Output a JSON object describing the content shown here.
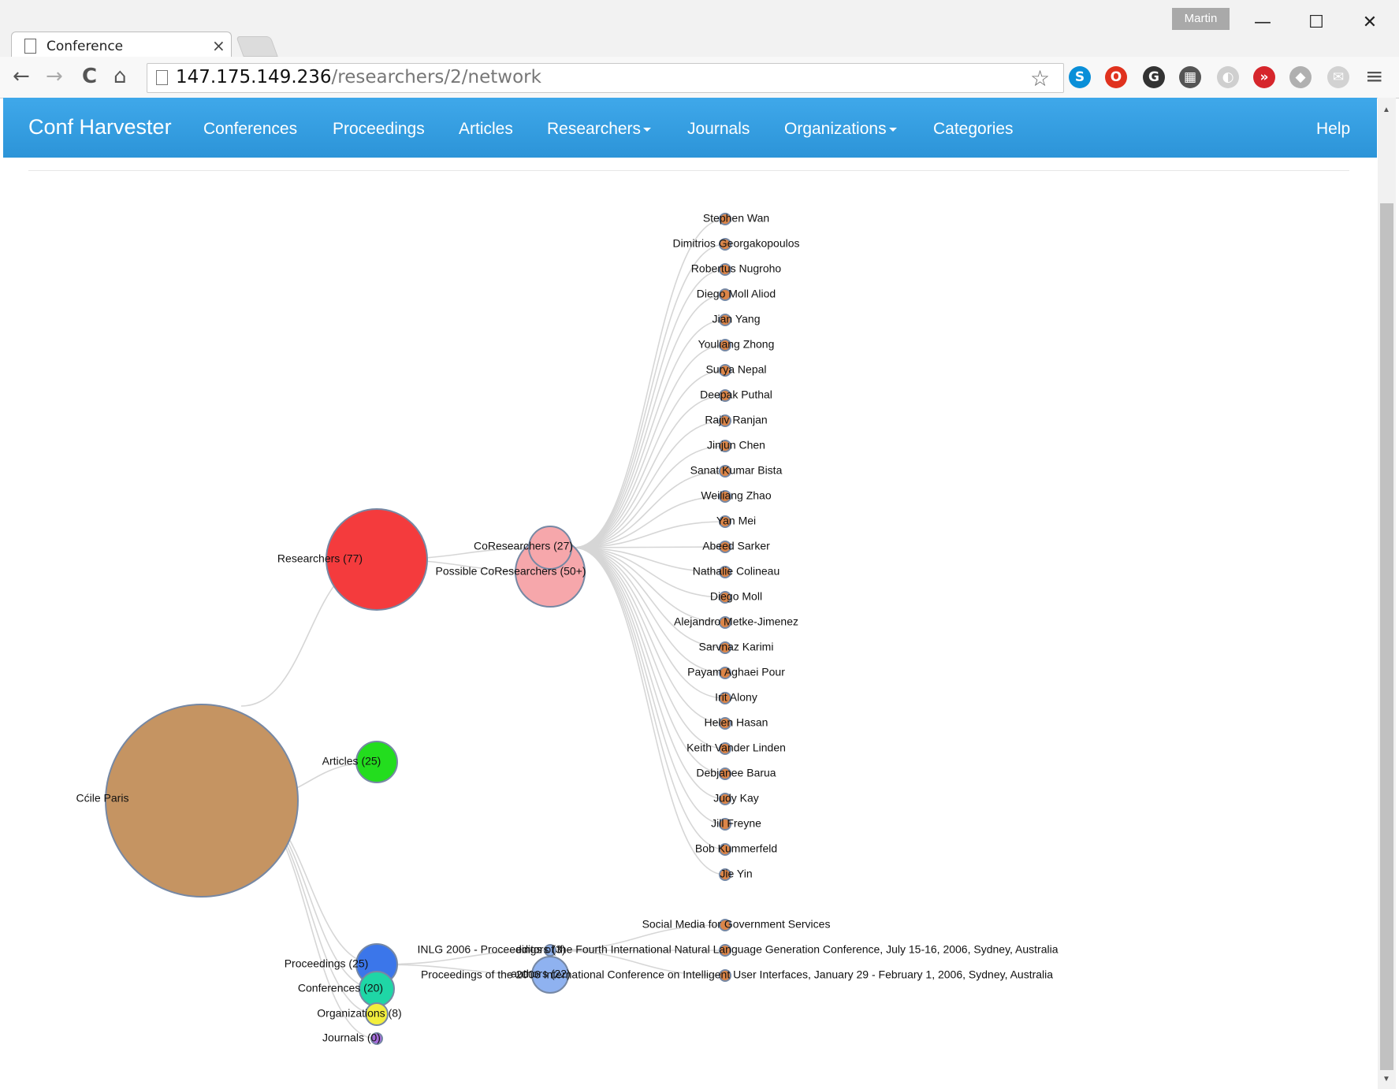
{
  "window": {
    "user_badge": "Martin",
    "minimize": "—",
    "maximize": "☐",
    "close": "✕"
  },
  "tab": {
    "title": "Conference",
    "close": "×"
  },
  "toolbar": {
    "back": "←",
    "forward": "→",
    "reload": "C",
    "home": "⌂",
    "url_host": "147.175.149.236",
    "url_path": "/researchers/2/network",
    "star": "☆",
    "extensions": [
      {
        "icon": "skype-icon",
        "glyph": "S",
        "color": "#0a8fd8"
      },
      {
        "icon": "opera-icon",
        "glyph": "O",
        "color": "#e0321e"
      },
      {
        "icon": "ghostery-icon",
        "glyph": "G",
        "color": "#333333"
      },
      {
        "icon": "clapper-icon",
        "glyph": "▦",
        "color": "#555555"
      },
      {
        "icon": "moon-icon",
        "glyph": "◐",
        "color": "#cfcfcf"
      },
      {
        "icon": "forward-icon",
        "glyph": "»",
        "color": "#d6262c"
      },
      {
        "icon": "box-icon",
        "glyph": "◆",
        "color": "#b0b0b0"
      },
      {
        "icon": "mail-icon",
        "glyph": "✉",
        "color": "#d2d2d2"
      }
    ],
    "menu": "≡"
  },
  "navbar": {
    "brand": "Conf Harvester",
    "links": [
      "Conferences",
      "Proceedings",
      "Articles",
      "Researchers",
      "Journals",
      "Organizations",
      "Categories"
    ],
    "help": "Help"
  },
  "graph": {
    "root": {
      "label": "Cćile Paris",
      "color": "#c59462"
    },
    "categories": [
      {
        "key": "researchers",
        "label": "Researchers (77)",
        "color": "#f43b3d"
      },
      {
        "key": "articles",
        "label": "Articles (25)",
        "color": "#23dd1e"
      },
      {
        "key": "proceedings",
        "label": "Proceedings (25)",
        "color": "#3b76ea"
      },
      {
        "key": "conferences",
        "label": "Conferences (20)",
        "color": "#1fd6a6"
      },
      {
        "key": "organizations",
        "label": "Organizations (8)",
        "color": "#f2ee3d"
      },
      {
        "key": "journals",
        "label": "Journals (0)",
        "color": "#a36cd9"
      }
    ],
    "researcher_groups": [
      {
        "label": "CoResearchers (27)",
        "color": "#f6a7ab"
      },
      {
        "label": "Possible CoResearchers (50+)",
        "color": "#f6a7ab"
      }
    ],
    "coresearchers": [
      "Stephen Wan",
      "Dimitrios Georgakopoulos",
      "Robertus Nugroho",
      "Diego Moll Aliod",
      "Jian Yang",
      "Youliang Zhong",
      "Surya Nepal",
      "Deepak Puthal",
      "Rajiv Ranjan",
      "Jinjun Chen",
      "Sanat Kumar Bista",
      "Weiliang Zhao",
      "Yan Mei",
      "Abeed Sarker",
      "Nathalie Colineau",
      "Diego Moll",
      "Alejandro Metke-Jimenez",
      "Sarvnaz Karimi",
      "Payam Aghaei Pour",
      "Irit Alony",
      "Helen Hasan",
      "Keith Vander Linden",
      "Debjanee Barua",
      "Judy Kay",
      "Jill Freyne",
      "Bob Kummerfeld",
      "Jie Yin"
    ],
    "proceeding_groups": [
      {
        "label": "editors (3)",
        "color": "#8fb2f0"
      },
      {
        "label": "authors (22)",
        "color": "#8fb2f0"
      }
    ],
    "proceedings": [
      "Social Media for Government Services",
      "INLG 2006 - Proceedings of the Fourth International Natural Language Generation Conference, July 15-16, 2006, Sydney, Australia",
      "Proceedings of the 2006 International Conference on Intelligent User Interfaces, January 29 - February 1, 2006, Sydney, Australia"
    ],
    "leaf_color": "#dc8548",
    "circle_stroke": "#7688a4"
  }
}
